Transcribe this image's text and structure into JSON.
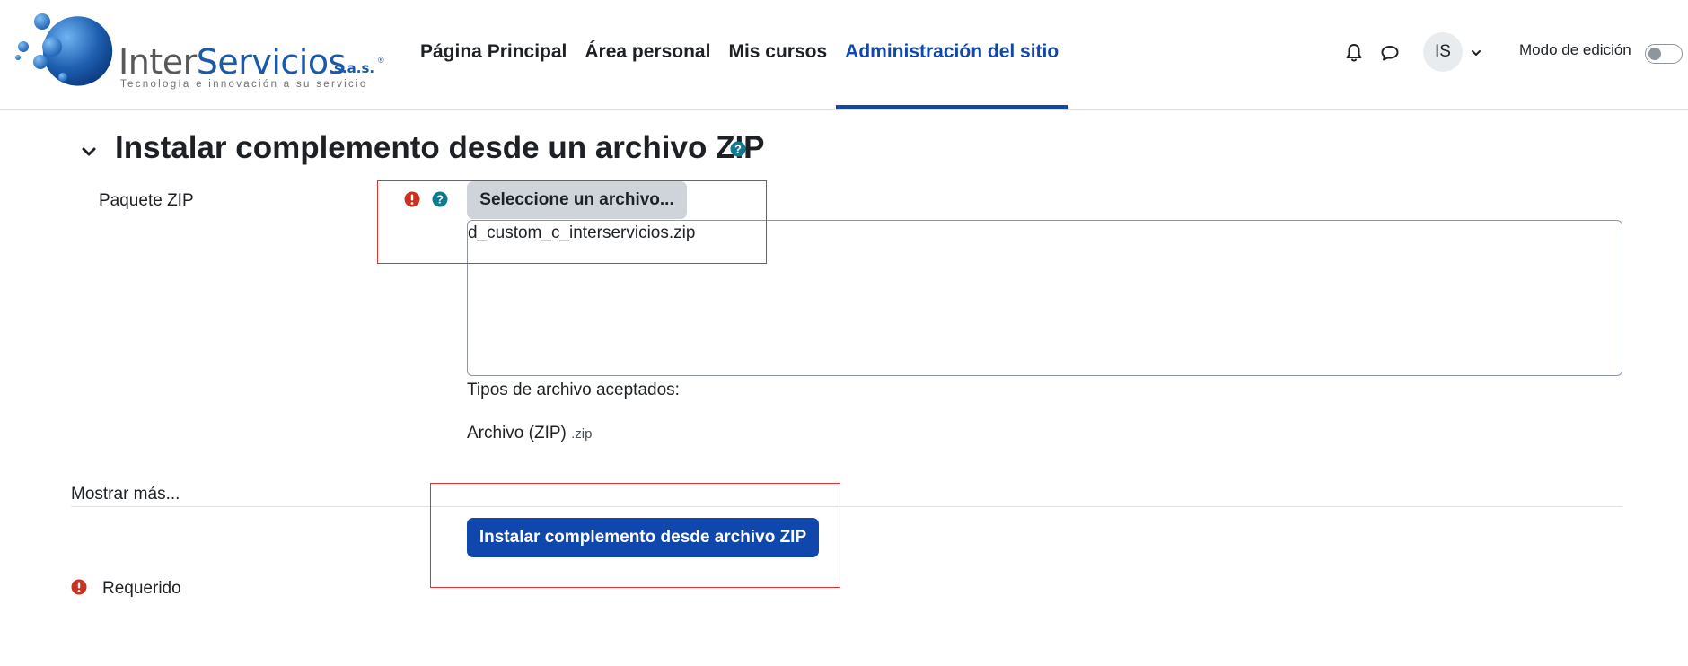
{
  "header": {
    "logo": {
      "brand_part1": "Inter",
      "brand_part2": "Servicios",
      "suffix": "s.a.s.",
      "registered": "®",
      "tagline": "Tecnología e innovación a su servicio"
    },
    "nav": [
      {
        "label": "Página Principal",
        "active": false
      },
      {
        "label": "Área personal",
        "active": false
      },
      {
        "label": "Mis cursos",
        "active": false
      },
      {
        "label": "Administración del sitio",
        "active": true
      }
    ],
    "icons": {
      "notifications": "bell-icon",
      "messages": "chat-bubble-icon",
      "menu": "chevron-down-icon"
    },
    "user_initials": "IS",
    "edit_mode_label": "Modo de edición",
    "edit_mode_on": false
  },
  "section": {
    "title": "Instalar complemento desde un archivo ZIP",
    "field_label": "Paquete ZIP",
    "choose_file_button": "Seleccione un archivo...",
    "selected_file": "d_custom_c_interservicios.zip",
    "accepted_types_label": "Tipos de archivo aceptados:",
    "accepted_type_name": "Archivo (ZIP)",
    "accepted_type_ext": ".zip",
    "show_more": "Mostrar más...",
    "submit_button": "Instalar complemento desde archivo ZIP",
    "required_label": "Requerido"
  },
  "colors": {
    "primary": "#0f47ad",
    "required_red": "#ca3120",
    "help_teal": "#0f6cbf",
    "highlight_box": "#e0312f"
  }
}
